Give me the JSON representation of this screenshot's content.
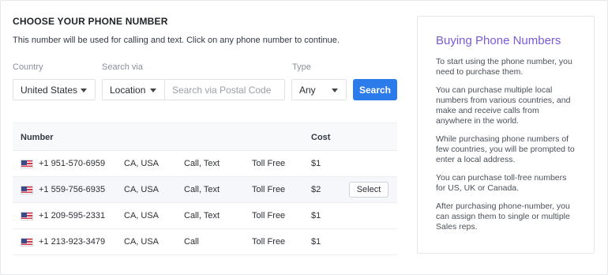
{
  "header": {
    "title": "CHOOSE YOUR PHONE NUMBER",
    "subtitle": "This number will be used for calling and text. Click on any phone number to continue."
  },
  "filters": {
    "country_label": "Country",
    "country_value": "United States",
    "search_via_label": "Search via",
    "search_via_value": "Location",
    "search_placeholder": "Search via Postal Code",
    "type_label": "Type",
    "type_value": "Any",
    "search_button": "Search"
  },
  "table": {
    "columns": {
      "number": "Number",
      "cost": "Cost"
    },
    "rows": [
      {
        "number": "+1 951-570-6959",
        "region": "CA, USA",
        "capabilities": "Call, Text",
        "kind": "Toll Free",
        "cost": "$1",
        "flag": "us-flag-icon"
      },
      {
        "number": "+1 559-756-6935",
        "region": "CA, USA",
        "capabilities": "Call, Text",
        "kind": "Toll Free",
        "cost": "$2",
        "flag": "us-flag-icon",
        "action": "Select",
        "hovered": true
      },
      {
        "number": "+1 209-595-2331",
        "region": "CA, USA",
        "capabilities": "Call, Text",
        "kind": "Toll Free",
        "cost": "$1",
        "flag": "us-flag-icon"
      },
      {
        "number": "+1 213-923-3479",
        "region": "CA, USA",
        "capabilities": "Call",
        "kind": "Toll Free",
        "cost": "$1",
        "flag": "us-flag-icon"
      }
    ]
  },
  "sidebar": {
    "title": "Buying Phone Numbers",
    "paragraphs": [
      "To start using the phone number, you need to purchase them.",
      "You can purchase multiple local numbers from various countries, and make and receive calls from anywhere in the world.",
      "While purchasing phone numbers of few countries, you will be prompted to enter a local address.",
      "You can purchase toll-free numbers for US, UK or Canada.",
      "After purchasing phone-number, you can assign them to single or multiple Sales reps."
    ]
  },
  "colors": {
    "accent": "#2b7bea",
    "sidebar_title": "#7a5ad8"
  }
}
